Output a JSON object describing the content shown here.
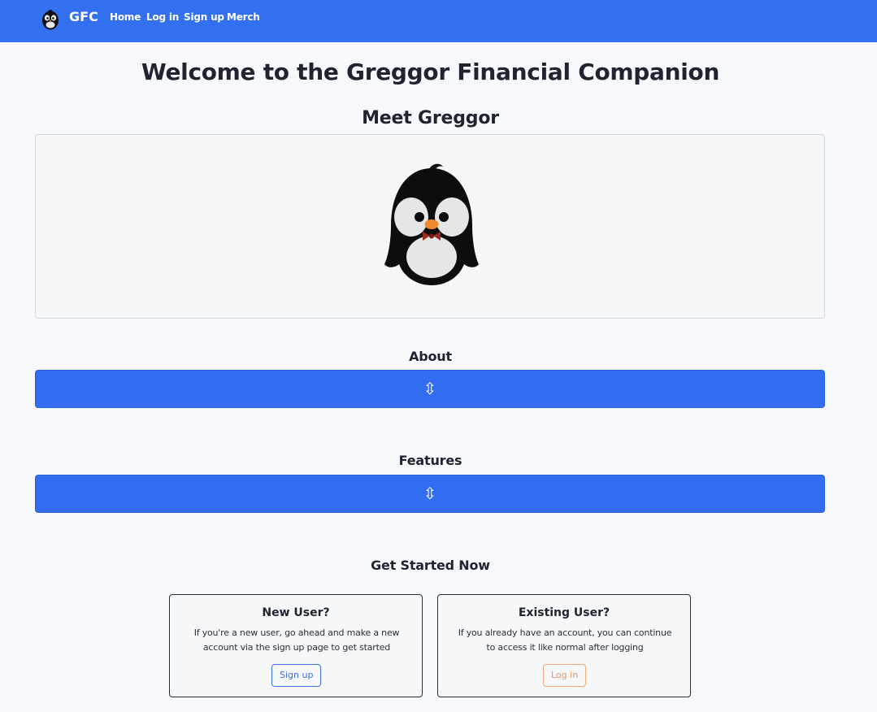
{
  "navbar": {
    "brand": "GFC",
    "links": [
      "Home",
      "Log in",
      "Sign up",
      "Merch"
    ],
    "background": "#3370f0"
  },
  "page_title": "Welcome to the Greggor Financial Companion",
  "mascot_section": {
    "heading": "Meet Greggor"
  },
  "about": {
    "heading": "About",
    "toggle_icon": "⇳"
  },
  "features": {
    "heading": "Features",
    "toggle_icon": "⇳"
  },
  "get_started": {
    "heading": "Get Started Now",
    "new_user": {
      "title": "New User?",
      "text": "If you're a new user, go ahead and make a new account via the sign up page to get started",
      "button": "Sign up"
    },
    "existing_user": {
      "title": "Existing User?",
      "text": "If you already have an account, you can continue to access it like normal after logging",
      "button": "Log in"
    }
  }
}
